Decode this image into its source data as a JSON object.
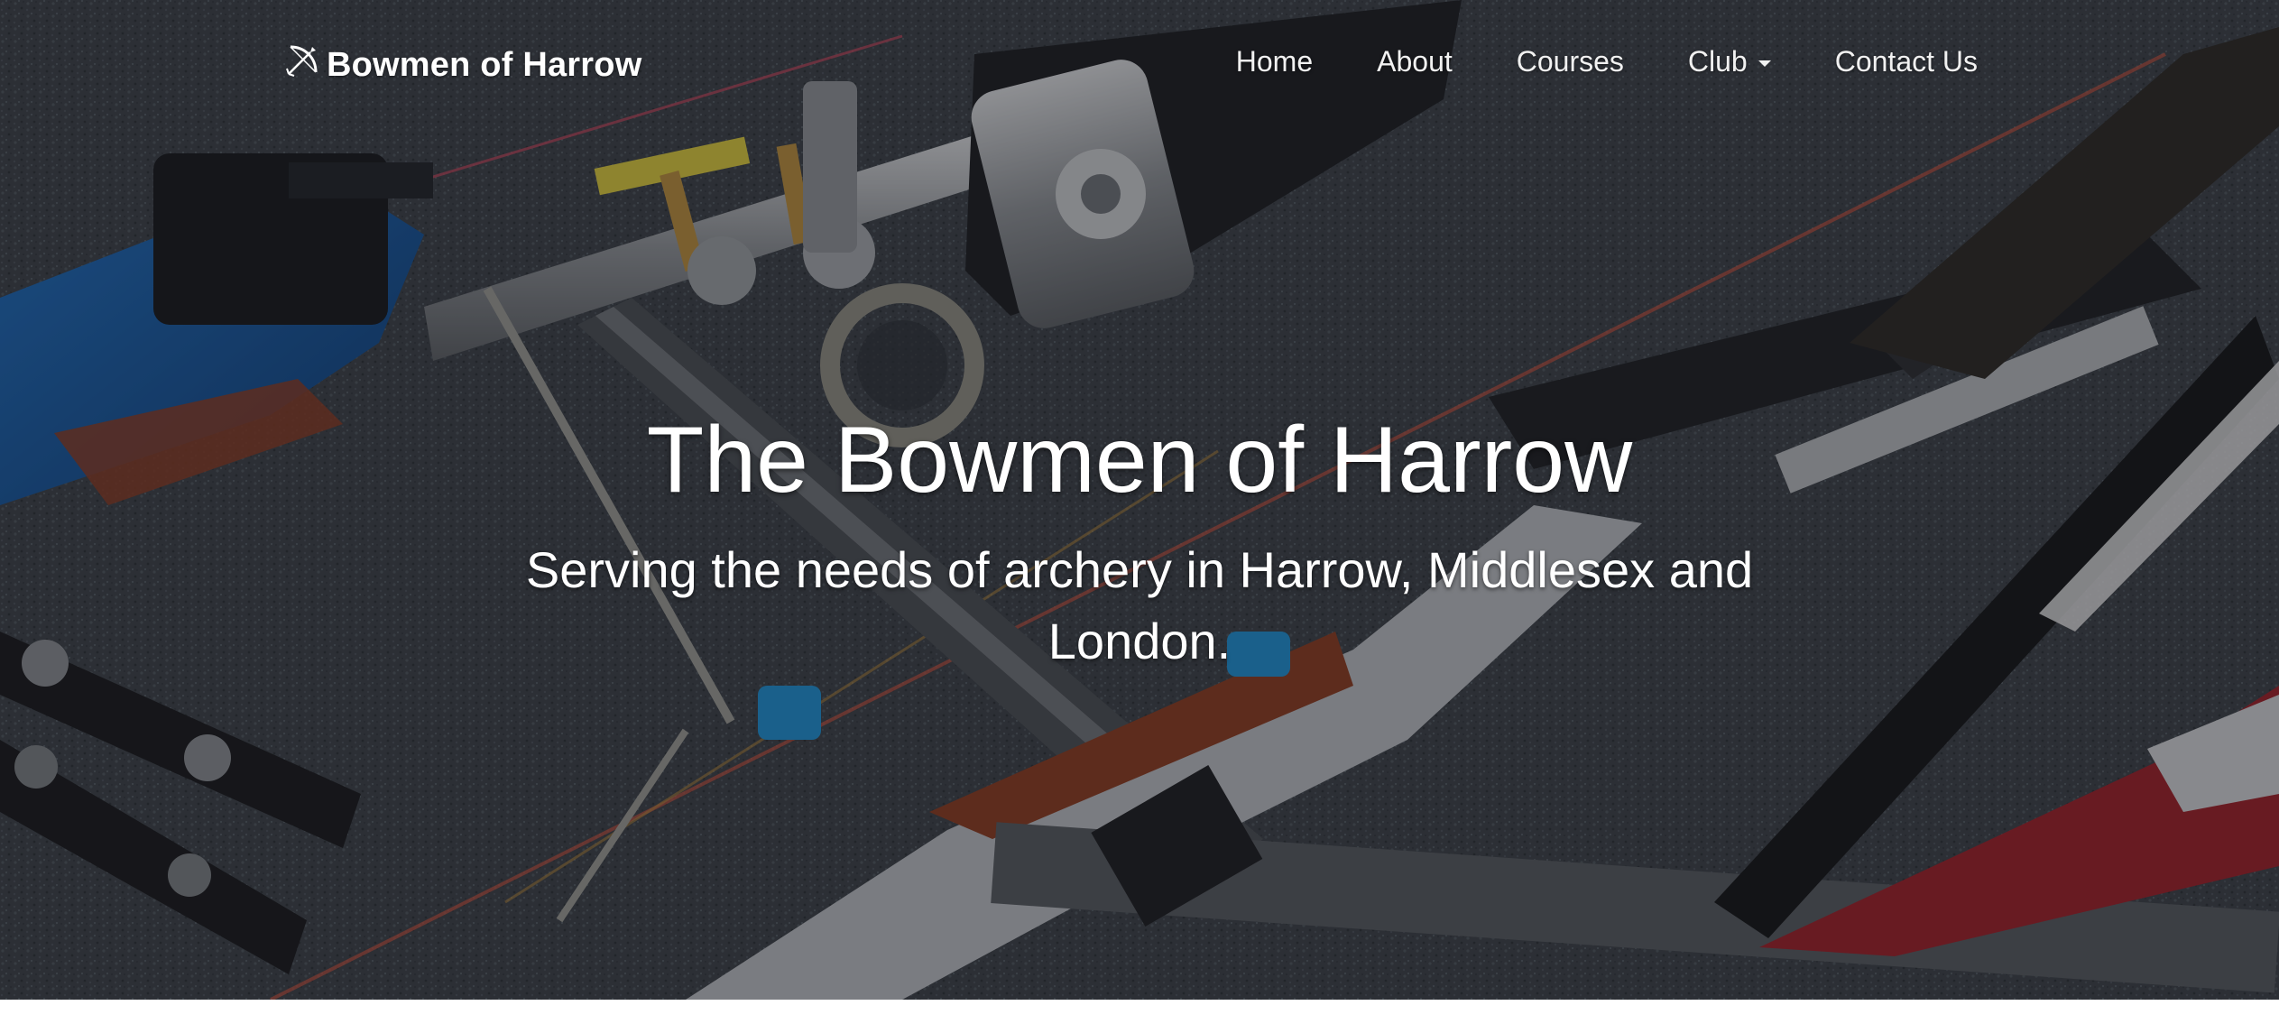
{
  "navbar": {
    "brand_label": "Bowmen of Harrow",
    "brand_icon": "bow-and-arrow-icon",
    "links": [
      {
        "label": "Home"
      },
      {
        "label": "About"
      },
      {
        "label": "Courses"
      },
      {
        "label": "Club",
        "has_dropdown": true
      },
      {
        "label": "Contact Us"
      }
    ]
  },
  "hero": {
    "title": "The Bowmen of Harrow",
    "subtitle": "Serving the needs of archery in Harrow, Middlesex and London.",
    "background_image": "archery-recurve-bows-photo"
  },
  "colors": {
    "text": "#ffffff",
    "nav_text": "#f1f1f1",
    "page_background": "#ffffff"
  }
}
